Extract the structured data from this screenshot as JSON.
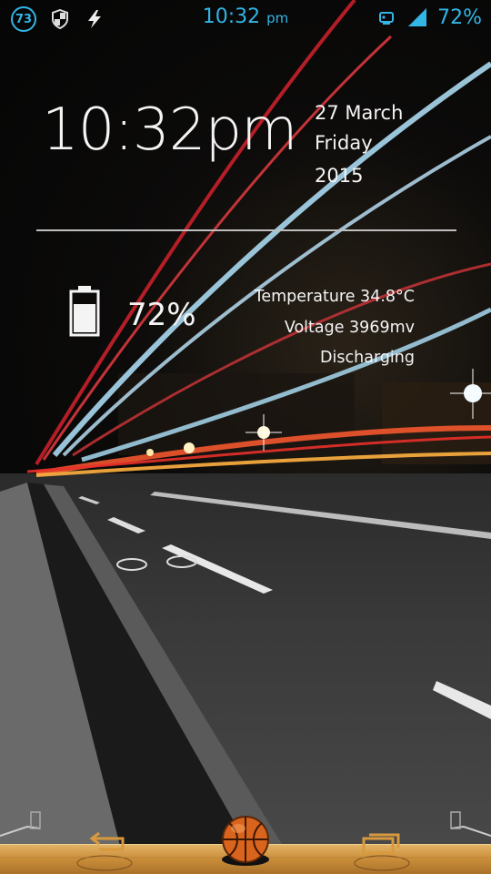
{
  "status_bar": {
    "notification_count": "73",
    "time": "10:32",
    "ampm": "pm",
    "battery": "72%",
    "icons": [
      "notification-count-icon",
      "shield-icon",
      "charging-bolt-icon",
      "alarm-icon",
      "signal-icon"
    ]
  },
  "clock_widget": {
    "time": "10:32pm",
    "date": "27 March",
    "weekday": "Friday",
    "year": "2015"
  },
  "battery_widget": {
    "percent": "72%",
    "level": 0.72,
    "temperature": "Temperature 34.8°C",
    "voltage": "Voltage 3969mv",
    "status": "Discharging"
  },
  "dock": {
    "icons": [
      "back-arrow-icon",
      "basketball-home-icon",
      "recent-apps-icon"
    ]
  },
  "colors": {
    "accent": "#33b5e5",
    "dock_wood": "#c98d3a",
    "text": "#f4f4f4"
  }
}
